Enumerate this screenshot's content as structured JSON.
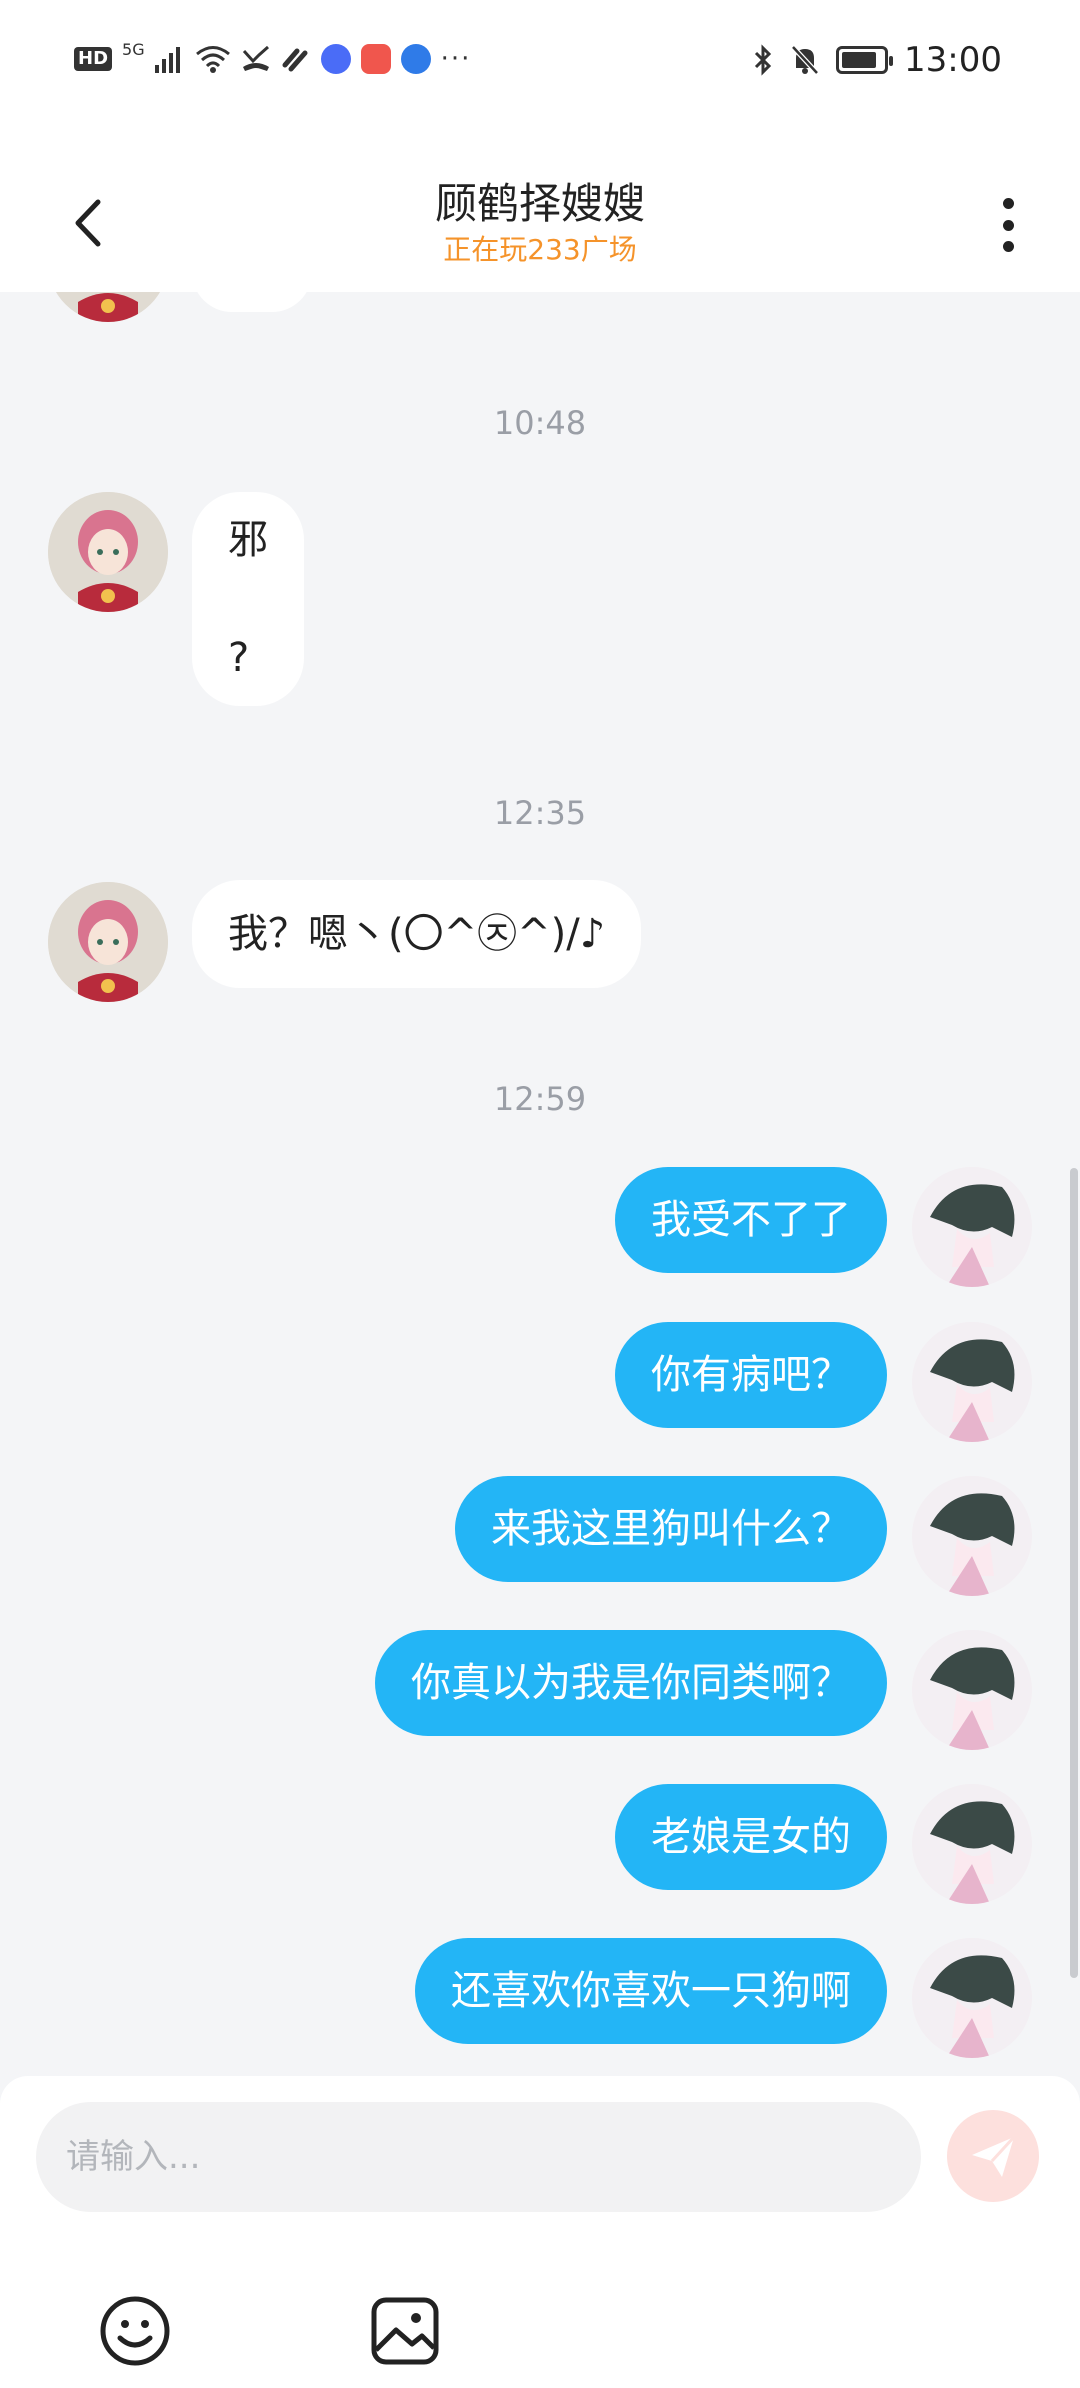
{
  "status_bar": {
    "hd": "HD",
    "network": "5G",
    "time": "13:00"
  },
  "header": {
    "title": "顾鹤择嫂嫂",
    "subtitle": "正在玩233广场",
    "subtitle_color": "#f5932a"
  },
  "messages": {
    "ts1": "10:48",
    "m1_line1": "邪",
    "m1_line2": "?",
    "ts2": "12:35",
    "m2": "我？嗯丶(〇^㉨^)/♪",
    "ts3": "12:59",
    "out": [
      "我受不了了",
      "你有病吧？",
      "来我这里狗叫什么？",
      "你真以为我是你同类啊？",
      "老娘是女的",
      "还喜欢你喜欢一只狗啊"
    ]
  },
  "input": {
    "placeholder": "请输入...",
    "value": ""
  },
  "icons": {
    "back": "chevron-left-icon",
    "more": "more-vertical-icon",
    "send": "send-paper-plane-icon",
    "emoji": "smile-face-icon",
    "image": "image-icon"
  },
  "colors": {
    "outgoing_bubble": "#23b5f6",
    "incoming_bubble": "#ffffff",
    "background": "#f4f5f7",
    "send_button": "#fde0dd"
  }
}
